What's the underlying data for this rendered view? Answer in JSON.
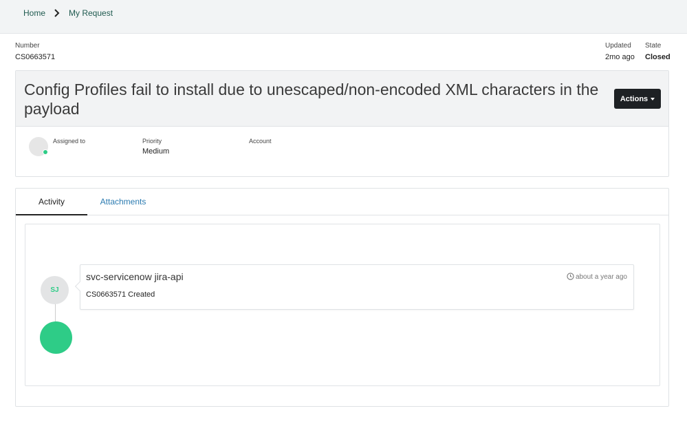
{
  "breadcrumb": {
    "home": "Home",
    "current": "My Request"
  },
  "meta": {
    "number_label": "Number",
    "number_value": "CS0663571",
    "updated_label": "Updated",
    "updated_value": "2mo ago",
    "state_label": "State",
    "state_value": "Closed"
  },
  "case": {
    "title": "Config Profiles fail to install due to unescaped/non-encoded XML characters in the payload",
    "actions_label": "Actions",
    "assigned_label": "Assigned to",
    "priority_label": "Priority",
    "priority_value": "Medium",
    "account_label": "Account"
  },
  "tabs": [
    {
      "label": "Activity",
      "active": true
    },
    {
      "label": "Attachments",
      "active": false
    }
  ],
  "activity": {
    "entries": [
      {
        "initials": "SJ",
        "author": "svc-servicenow jira-api",
        "time": "about a year ago",
        "text": "CS0663571 Created"
      }
    ]
  },
  "colors": {
    "accent_green": "#2ecc87",
    "link_blue": "#2a7ab0",
    "breadcrumb_green": "#1f5a4f",
    "dark_button": "#1e2124"
  },
  "icons": {
    "breadcrumb_separator": "chevron-right-icon",
    "time": "clock-icon",
    "actions_dropdown": "caret-down-icon"
  }
}
